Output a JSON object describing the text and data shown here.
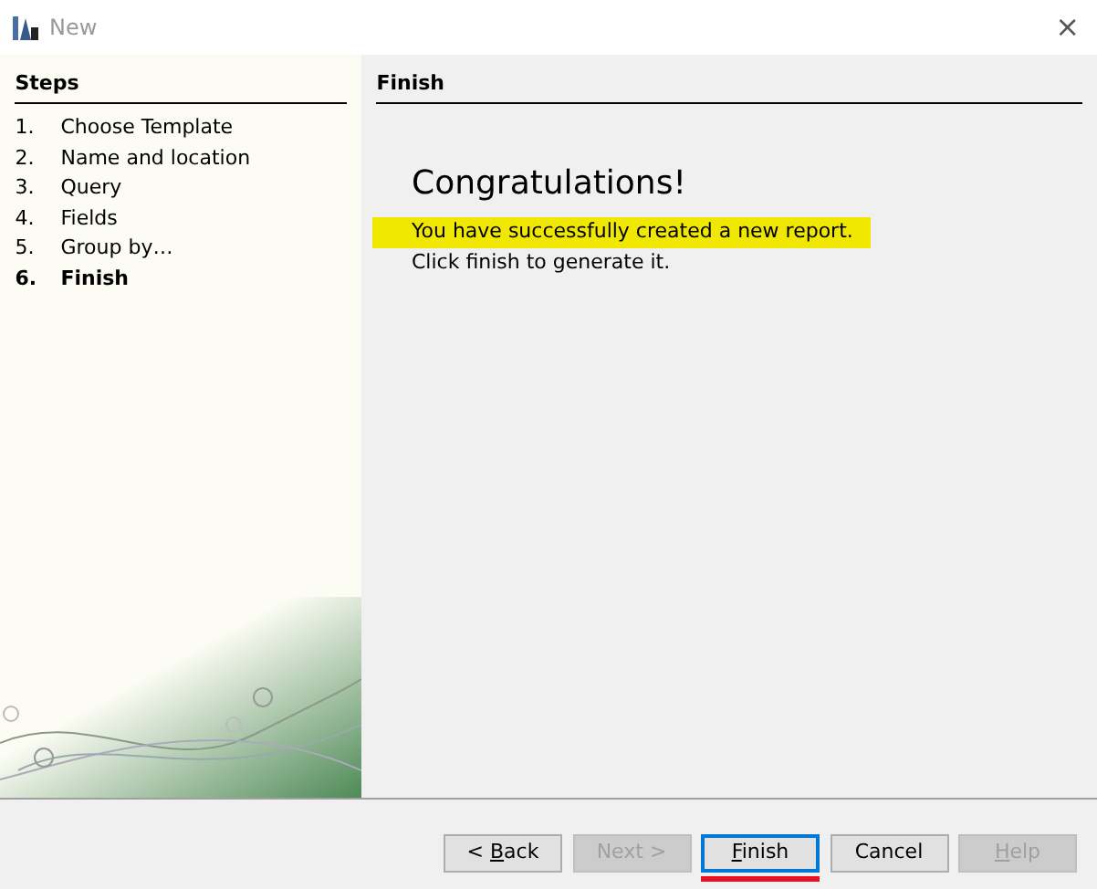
{
  "window": {
    "title": "New",
    "close": "×"
  },
  "steps": {
    "heading": "Steps",
    "items": [
      {
        "number": "1.",
        "label": "Choose Template",
        "selected": false
      },
      {
        "number": "2.",
        "label": "Name and location",
        "selected": false
      },
      {
        "number": "3.",
        "label": "Query",
        "selected": false
      },
      {
        "number": "4.",
        "label": "Fields",
        "selected": false
      },
      {
        "number": "5.",
        "label": "Group by…",
        "selected": false
      },
      {
        "number": "6.",
        "label": "Finish",
        "selected": true
      }
    ]
  },
  "page": {
    "heading": "Finish",
    "title": "Congratulations!",
    "lines": [
      {
        "text": "You have successfully created a new report.",
        "highlighted": true
      },
      {
        "text": "Click finish to generate it.",
        "highlighted": false
      }
    ]
  },
  "buttons": [
    {
      "before": "< ",
      "key": "B",
      "after": "ack",
      "disabled": false,
      "focused": false,
      "marked": false
    },
    {
      "before": "Next >",
      "disabled": true,
      "focused": false,
      "marked": false
    },
    {
      "key": "F",
      "after": "inish",
      "disabled": false,
      "focused": true,
      "marked": true
    },
    {
      "before": "Cancel",
      "disabled": false,
      "focused": false,
      "marked": false
    },
    {
      "key": "H",
      "after": "elp",
      "disabled": true,
      "focused": false,
      "marked": false
    }
  ]
}
